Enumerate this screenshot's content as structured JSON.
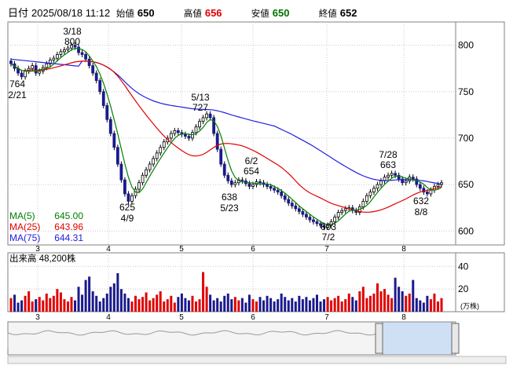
{
  "header": {
    "date_label": "日付",
    "datetime": "2025/08/18 11:12",
    "open_label": "始値",
    "open": "650",
    "high_label": "高値",
    "high": "656",
    "low_label": "安値",
    "low": "650",
    "close_label": "終値",
    "close": "652"
  },
  "ma_legend": [
    {
      "label": "MA(5)",
      "value": "645.00",
      "color": "#008000"
    },
    {
      "label": "MA(25)",
      "value": "643.96",
      "color": "#e00000"
    },
    {
      "label": "MA(75)",
      "value": "644.31",
      "color": "#2020e0"
    }
  ],
  "volume_legend": {
    "label": "出来高",
    "value": "48,200株"
  },
  "volume_unit": "(万株)",
  "colors": {
    "up": "#e00000",
    "down": "#1a1a8c",
    "ma5": "#008000",
    "ma25": "#e00000",
    "ma75": "#2020e0",
    "grid": "#c8c8c8"
  },
  "chart_data": {
    "type": "candlestick",
    "price_axis": {
      "ticks": [
        600,
        650,
        700,
        750,
        800
      ],
      "ylim": [
        585,
        825
      ]
    },
    "volume_axis": {
      "ticks": [
        20,
        40
      ],
      "ylim": [
        0,
        52
      ],
      "unit": "万株"
    },
    "x_month_labels": [
      "3",
      "4",
      "5",
      "6",
      "7",
      "8"
    ],
    "annotations": [
      {
        "date_label": "3/18",
        "price_label": "800",
        "kind": "high"
      },
      {
        "date_label": "2/21",
        "price_label": "764",
        "kind": "low"
      },
      {
        "date_label": "4/9",
        "price_label": "625",
        "kind": "low"
      },
      {
        "date_label": "5/13",
        "price_label": "727",
        "kind": "high"
      },
      {
        "date_label": "5/23",
        "price_label": "638",
        "kind": "low"
      },
      {
        "date_label": "6/2",
        "price_label": "654",
        "kind": "high"
      },
      {
        "date_label": "7/2",
        "price_label": "603",
        "kind": "low"
      },
      {
        "date_label": "7/28",
        "price_label": "663",
        "kind": "high"
      },
      {
        "date_label": "8/8",
        "price_label": "632",
        "kind": "low"
      }
    ],
    "close_path": [
      780,
      775,
      770,
      766,
      772,
      775,
      778,
      770,
      772,
      776,
      780,
      784,
      786,
      790,
      793,
      795,
      797,
      800,
      798,
      792,
      790,
      785,
      778,
      770,
      762,
      750,
      735,
      720,
      705,
      690,
      672,
      655,
      640,
      632,
      638,
      645,
      652,
      660,
      666,
      672,
      678,
      684,
      690,
      696,
      700,
      705,
      708,
      706,
      704,
      702,
      700,
      706,
      712,
      718,
      722,
      726,
      722,
      705,
      688,
      672,
      660,
      654,
      650,
      652,
      655,
      654,
      651,
      648,
      650,
      653,
      652,
      650,
      648,
      646,
      644,
      642,
      638,
      634,
      630,
      627,
      624,
      621,
      618,
      615,
      612,
      610,
      608,
      606,
      604,
      606,
      610,
      615,
      620,
      622,
      624,
      625,
      622,
      620,
      626,
      632,
      638,
      642,
      646,
      650,
      654,
      658,
      660,
      662,
      660,
      656,
      652,
      654,
      658,
      656,
      650,
      646,
      642,
      640,
      644,
      648,
      650,
      652
    ],
    "volume": [
      12,
      15,
      8,
      10,
      14,
      18,
      9,
      11,
      13,
      10,
      16,
      12,
      14,
      20,
      17,
      11,
      9,
      13,
      10,
      22,
      15,
      28,
      31,
      18,
      14,
      9,
      12,
      16,
      22,
      25,
      34,
      20,
      16,
      12,
      9,
      14,
      11,
      13,
      17,
      10,
      12,
      15,
      18,
      9,
      11,
      14,
      8,
      13,
      16,
      12,
      10,
      14,
      9,
      11,
      35,
      22,
      15,
      10,
      12,
      9,
      14,
      16,
      11,
      13,
      10,
      12,
      8,
      15,
      11,
      9,
      13,
      10,
      14,
      12,
      9,
      11,
      16,
      13,
      10,
      12,
      9,
      14,
      11,
      13,
      10,
      12,
      15,
      9,
      11,
      13,
      10,
      12,
      14,
      9,
      11,
      16,
      13,
      10,
      18,
      22,
      12,
      14,
      16,
      25,
      18,
      20,
      15,
      12,
      30,
      22,
      18,
      14,
      16,
      28,
      12,
      10,
      8,
      14,
      11,
      16,
      9,
      12
    ]
  }
}
